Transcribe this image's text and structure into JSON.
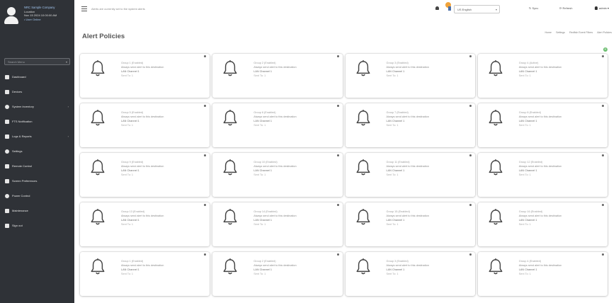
{
  "sidebar": {
    "brand": {
      "title": "NRC Sample Company",
      "line2": "Location",
      "line3": "Nov 15 2024 10:00:00 AM",
      "status": "• User Online"
    },
    "search_placeholder": "Search Menu",
    "items": [
      {
        "label": "Dashboard",
        "icon": "home-icon",
        "has_submenu": false
      },
      {
        "label": "Devices",
        "icon": "devices-icon",
        "has_submenu": false
      },
      {
        "label": "System Inventory",
        "icon": "inventory-icon",
        "has_submenu": true
      },
      {
        "label": "FTS Notification",
        "icon": "notification-icon",
        "has_submenu": false
      },
      {
        "label": "Logs & Reports",
        "icon": "chart-icon",
        "has_submenu": true
      },
      {
        "label": "Settings",
        "icon": "gear-icon",
        "has_submenu": false
      },
      {
        "label": "Remote Control",
        "icon": "remote-icon",
        "has_submenu": false
      },
      {
        "label": "Screen Preferences",
        "icon": "screen-icon",
        "has_submenu": false
      },
      {
        "label": "Power Control",
        "icon": "power-icon",
        "has_submenu": false
      },
      {
        "label": "Maintenance",
        "icon": "wrench-icon",
        "has_submenu": false
      },
      {
        "label": "Sign out",
        "icon": "signout-icon",
        "has_submenu": false
      }
    ]
  },
  "topbar": {
    "alert_message": "Alerts are currently set to the system alerts",
    "language": "US English",
    "sync_label": "Sync",
    "refresh_label": "Refresh",
    "user_label": "admin ▾"
  },
  "page": {
    "title": "Alert Policies",
    "breadcrumb": [
      "Home",
      "Settings",
      "Redfish Event Filters",
      "Alert Policies"
    ]
  },
  "policies": [
    {
      "group": "Group 1 (Enabled)",
      "desc": "Always send alert to this destination",
      "target": "LAN Channel 1",
      "send": "Sent To: 1"
    },
    {
      "group": "Group 2 (Enabled)",
      "desc": "Always send alert to this destination",
      "target": "LAN Channel 1",
      "send": "Sent To: 1"
    },
    {
      "group": "Group 3 (Enabled)",
      "desc": "Always send alert to this destination",
      "target": "LAN Channel 1",
      "send": "Sent To: 1"
    },
    {
      "group": "Group 4 (Active)",
      "desc": "Always send alert to this destination",
      "target": "LAN Channel 1",
      "send": "Sent To: 1"
    },
    {
      "group": "Group 5 (Enabled)",
      "desc": "Always send alert to this destination",
      "target": "LAN Channel 1",
      "send": "Sent To: 1"
    },
    {
      "group": "Group 6 (Enabled)",
      "desc": "Always send alert to this destination",
      "target": "LAN Channel 1",
      "send": "Sent To: 1"
    },
    {
      "group": "Group 7 (Enabled)",
      "desc": "Always send alert to this destination",
      "target": "LAN Channel 1",
      "send": "Sent To: 1"
    },
    {
      "group": "Group 8 (Enabled)",
      "desc": "Always send alert to this destination",
      "target": "LAN Channel 1",
      "send": "Sent To: 1"
    },
    {
      "group": "Group 9 (Enabled)",
      "desc": "Always send alert to this destination",
      "target": "LAN Channel 1",
      "send": "Sent To: 1"
    },
    {
      "group": "Group 10 (Enabled)",
      "desc": "Always send alert to this destination",
      "target": "LAN Channel 1",
      "send": "Sent To: 1"
    },
    {
      "group": "Group 11 (Enabled)",
      "desc": "Always send alert to this destination",
      "target": "LAN Channel 1",
      "send": "Sent To: 1"
    },
    {
      "group": "Group 12 (Enabled)",
      "desc": "Always send alert to this destination",
      "target": "LAN Channel 1",
      "send": "Sent To: 1"
    },
    {
      "group": "Group 13 (Enabled)",
      "desc": "Always send alert to this destination",
      "target": "LAN Channel 1",
      "send": "Sent To: 1"
    },
    {
      "group": "Group 14 (Enabled)",
      "desc": "Always send alert to this destination",
      "target": "LAN Channel 1",
      "send": "Sent To: 1"
    },
    {
      "group": "Group 15 (Enabled)",
      "desc": "Always send alert to this destination",
      "target": "LAN Channel 1",
      "send": "Sent To: 1"
    },
    {
      "group": "Group 16 (Enabled)",
      "desc": "Always send alert to this destination",
      "target": "LAN Channel 1",
      "send": "Sent To: 1"
    },
    {
      "group": "Group 1 (Enabled)",
      "desc": "Always send alert to this destination",
      "target": "LAN Channel 1",
      "send": "Sent To: 1"
    },
    {
      "group": "Group 2 (Enabled)",
      "desc": "Always send alert to this destination",
      "target": "LAN Channel 1",
      "send": "Sent To: 1"
    },
    {
      "group": "Group 3 (Enabled)",
      "desc": "Always send alert to this destination",
      "target": "LAN Channel 1",
      "send": "Sent To: 1"
    },
    {
      "group": "Group 4 (Enabled)",
      "desc": "Always send alert to this destination",
      "target": "LAN Channel 1",
      "send": "Sent To: 1"
    }
  ],
  "colors": {
    "sidebar_bg": "#2f3237",
    "accent_link": "#9fc2ea",
    "add_button": "#6fbf73"
  }
}
